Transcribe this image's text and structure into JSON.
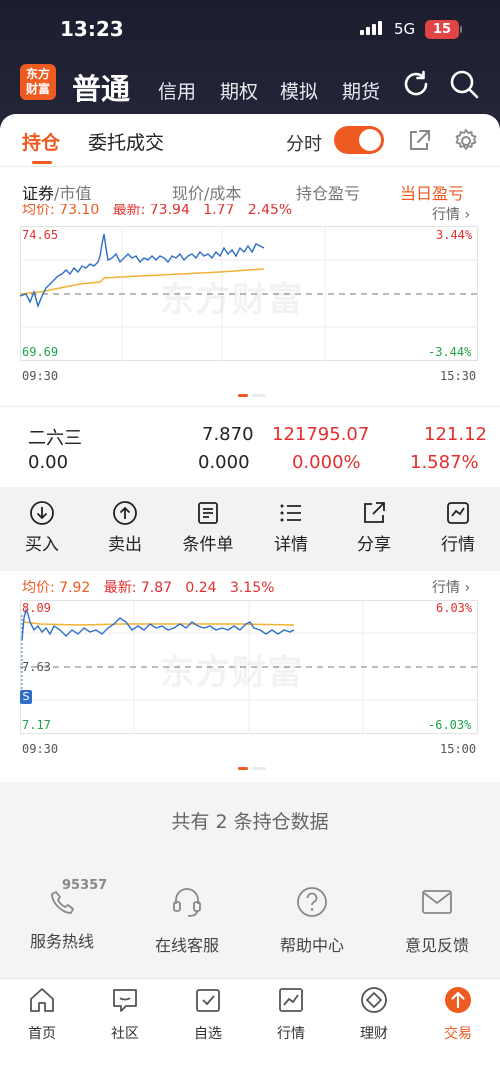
{
  "status_bar": {
    "time": "13:23",
    "network": "5G",
    "battery": "15"
  },
  "header": {
    "logo_text": "东方财富",
    "nav": [
      "普通",
      "信用",
      "期权",
      "模拟",
      "期货"
    ]
  },
  "tabs": {
    "holdings": "持仓",
    "orders": "委托成交",
    "timeshare_label": "分时",
    "timeshare_on": true
  },
  "columns": {
    "security": "证券",
    "market_value": "/市值",
    "price": "现价/成本",
    "position_pnl": "持仓盈亏",
    "daily_pnl": "当日盈亏"
  },
  "chart1": {
    "info_avg": "均价: 73.10",
    "info_latest": "最新: 73.94",
    "info_change": "1.77",
    "info_pct": "2.45%",
    "hq_link": "行情",
    "y_top": "74.65",
    "y_bottom": "69.69",
    "pct_top": "3.44%",
    "pct_bottom": "-3.44%",
    "x_start": "09:30",
    "x_end": "15:30",
    "watermark": "东方财富"
  },
  "holding": {
    "name": "二六三",
    "price": "7.870",
    "market_value": "121795.07",
    "position_pnl": "121.12",
    "quantity": "0.00",
    "cost": "0.000",
    "position_pnl_pct": "0.000%",
    "daily_pnl_pct": "1.587%"
  },
  "actions": [
    "买入",
    "卖出",
    "条件单",
    "详情",
    "分享",
    "行情"
  ],
  "chart2": {
    "info_avg": "均价: 7.92",
    "info_latest": "最新: 7.87",
    "info_change": "0.24",
    "info_pct": "3.15%",
    "hq_link": "行情",
    "y_top": "8.09",
    "y_mid": "7.63",
    "y_bottom": "7.17",
    "pct_top": "6.03%",
    "pct_bottom": "-6.03%",
    "x_start": "09:30",
    "x_end": "15:00",
    "marker": "S",
    "watermark": "东方财富"
  },
  "summary": "共有 2 条持仓数据",
  "services": [
    {
      "label": "服务热线",
      "badge": "95357",
      "icon": "phone-icon"
    },
    {
      "label": "在线客服",
      "icon": "headset-icon"
    },
    {
      "label": "帮助中心",
      "icon": "help-icon"
    },
    {
      "label": "意见反馈",
      "icon": "feedback-icon"
    }
  ],
  "bottom_nav": [
    "首页",
    "社区",
    "自选",
    "行情",
    "理财",
    "交易"
  ],
  "colors": {
    "accent": "#ee5a1f",
    "up": "#e62e2e",
    "down": "#1ea34a",
    "price_line": "#2f6fc9",
    "avg_line": "#f2b233"
  }
}
